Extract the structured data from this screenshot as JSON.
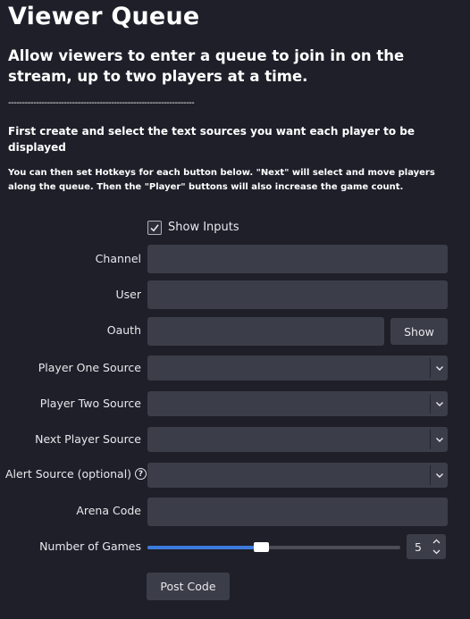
{
  "header": {
    "title": "Viewer Queue",
    "subtitle": "Allow viewers to enter a queue to join in on the stream, up to two players at a time.",
    "divider": "-------------------------------------------------------------------",
    "instructions_1": "First create and select the text sources you want each player to be displayed",
    "instructions_2": "You can then set Hotkeys for each button below.  \"Next\" will select and move players along the queue. Then the \"Player\" buttons will also increase the game count."
  },
  "form": {
    "show_inputs": {
      "label": "Show Inputs",
      "checked": true
    },
    "channel": {
      "label": "Channel",
      "value": ""
    },
    "user": {
      "label": "User",
      "value": ""
    },
    "oauth": {
      "label": "Oauth",
      "value": "",
      "show_button": "Show"
    },
    "player_one_source": {
      "label": "Player One Source",
      "value": ""
    },
    "player_two_source": {
      "label": "Player Two Source",
      "value": ""
    },
    "next_player_source": {
      "label": "Next Player Source",
      "value": ""
    },
    "alert_source": {
      "label": "Alert Source (optional)",
      "help_icon": "?",
      "value": ""
    },
    "arena_code": {
      "label": "Arena Code",
      "value": ""
    },
    "number_of_games": {
      "label": "Number of Games",
      "value": "5",
      "slider_fraction": 0.45
    },
    "post_code_button": "Post Code"
  },
  "colors": {
    "background": "#1e1f29",
    "input": "#3b3d48",
    "accent": "#3c7bdc",
    "text": "#e8e8ec"
  },
  "icons": {
    "checkbox": "check-icon",
    "dropdown": "chevron-down-icon",
    "help": "question-circle-icon",
    "spin_up": "chevron-up-icon",
    "spin_down": "chevron-down-icon"
  }
}
